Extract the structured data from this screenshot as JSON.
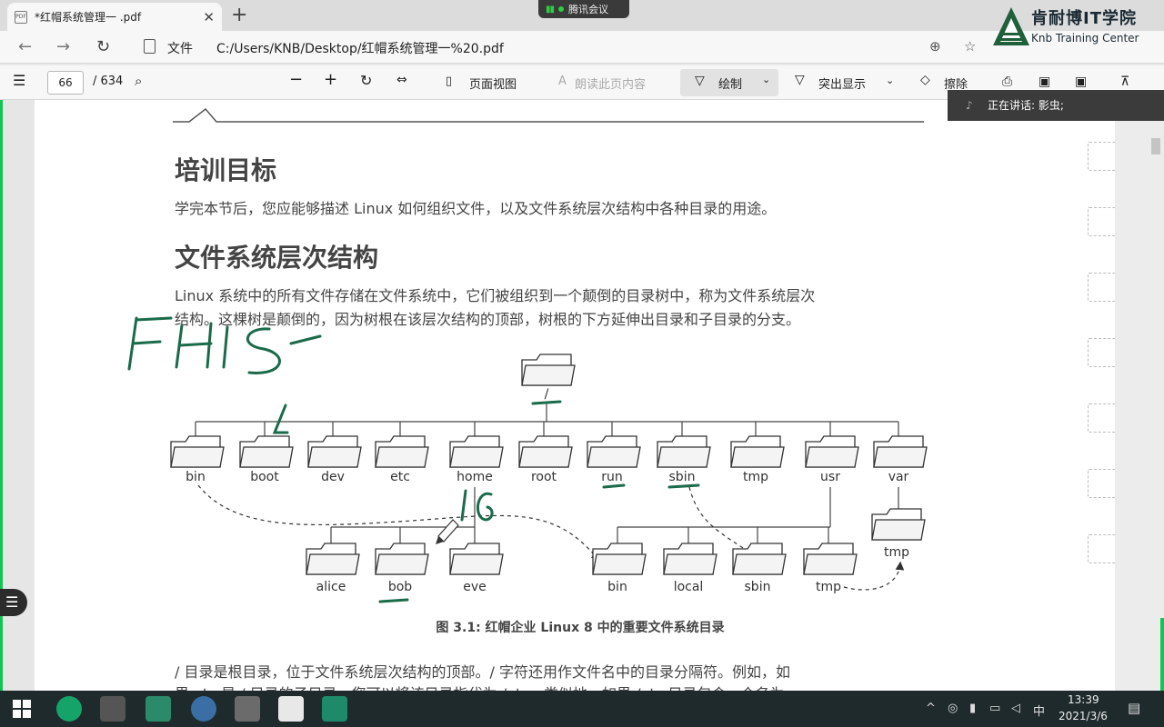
{
  "browser": {
    "tab_title": "*红帽系统管理一 .pdf",
    "tab_close": "✕",
    "new_tab": "+",
    "meeting": "腾讯会议",
    "address_label": "文件",
    "url": "C:/Users/KNB/Desktop/红帽系统管理一%20.pdf"
  },
  "logo": {
    "name": "肯耐博IT学院",
    "subtitle": "Knb Training Center"
  },
  "pdf_toolbar": {
    "page_current": "66",
    "page_total": "/ 634",
    "page_view": "页面视图",
    "read_aloud": "朗读此页内容",
    "draw": "绘制",
    "highlight": "突出显示",
    "erase": "擦除"
  },
  "meeting_overlay": {
    "speaking": "正在讲话: 影虫;"
  },
  "document": {
    "heading1": "培训目标",
    "para1": "学完本节后，您应能够描述 Linux 如何组织文件，以及文件系统层次结构中各种目录的用途。",
    "heading2": "文件系统层次结构",
    "para2_line1": "Linux 系统中的所有文件存储在文件系统中，它们被组织到一个颠倒的目录树中，称为文件系统层次",
    "para2_line2": "结构。这棵树是颠倒的，因为树根在该层次结构的顶部，树根的下方延伸出目录和子目录的分支。",
    "figure_caption": "图 3.1: 红帽企业 Linux 8 中的重要文件系统目录",
    "para3_line1": "/ 目录是根目录，位于文件系统层次结构的顶部。/ 字符还用作文件名中的目录分隔符。例如，如",
    "para3_line2": "果 etc 是 / 目录的子目录，您可以将该目录指代为 /etc。类似地，如果 /etc 目录包含一个名为"
  },
  "diagram": {
    "root_label": "/",
    "top_dirs": [
      "bin",
      "boot",
      "dev",
      "etc",
      "home",
      "root",
      "run",
      "sbin",
      "tmp",
      "usr",
      "var"
    ],
    "home_dirs": [
      "alice",
      "bob",
      "eve"
    ],
    "usr_dirs": [
      "bin",
      "local",
      "sbin",
      "tmp"
    ],
    "var_dirs": [
      "tmp"
    ]
  },
  "annotations": {
    "fhs": "FHS",
    "lg": "lG"
  },
  "taskbar": {
    "ime": "中",
    "time": "13:39",
    "date": "2021/3/6"
  },
  "colors": {
    "annotation_green": "#1a6b4a",
    "accent_green": "#12c454",
    "taskbar": "#1f2a2c"
  }
}
